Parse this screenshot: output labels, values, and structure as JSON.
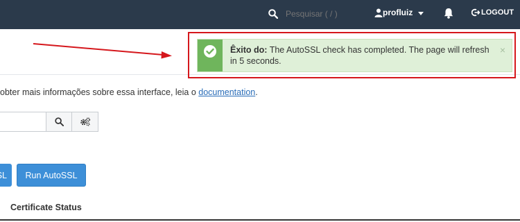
{
  "topbar": {
    "search_placeholder": "Pesquisar ( / )",
    "username": "profluiz",
    "logout_label": "LOGOUT",
    "background": "#2b3a4b"
  },
  "notice": {
    "title": "Êxito do:",
    "message": "The AutoSSL check has completed. The page will refresh in 5 seconds.",
    "close_label": "×",
    "icon": "check-circle-icon",
    "color": "#dff0d8",
    "accent": "#6fb55c",
    "highlight_color": "#d5171c"
  },
  "intro": {
    "text": "obter mais informações sobre essa interface, leia o ",
    "link": "documentation",
    "suffix": "."
  },
  "actions": {
    "partial_label": "SL",
    "run_label": "Run AutoSSL"
  },
  "table": {
    "columns": [
      "Certificate Status"
    ]
  }
}
